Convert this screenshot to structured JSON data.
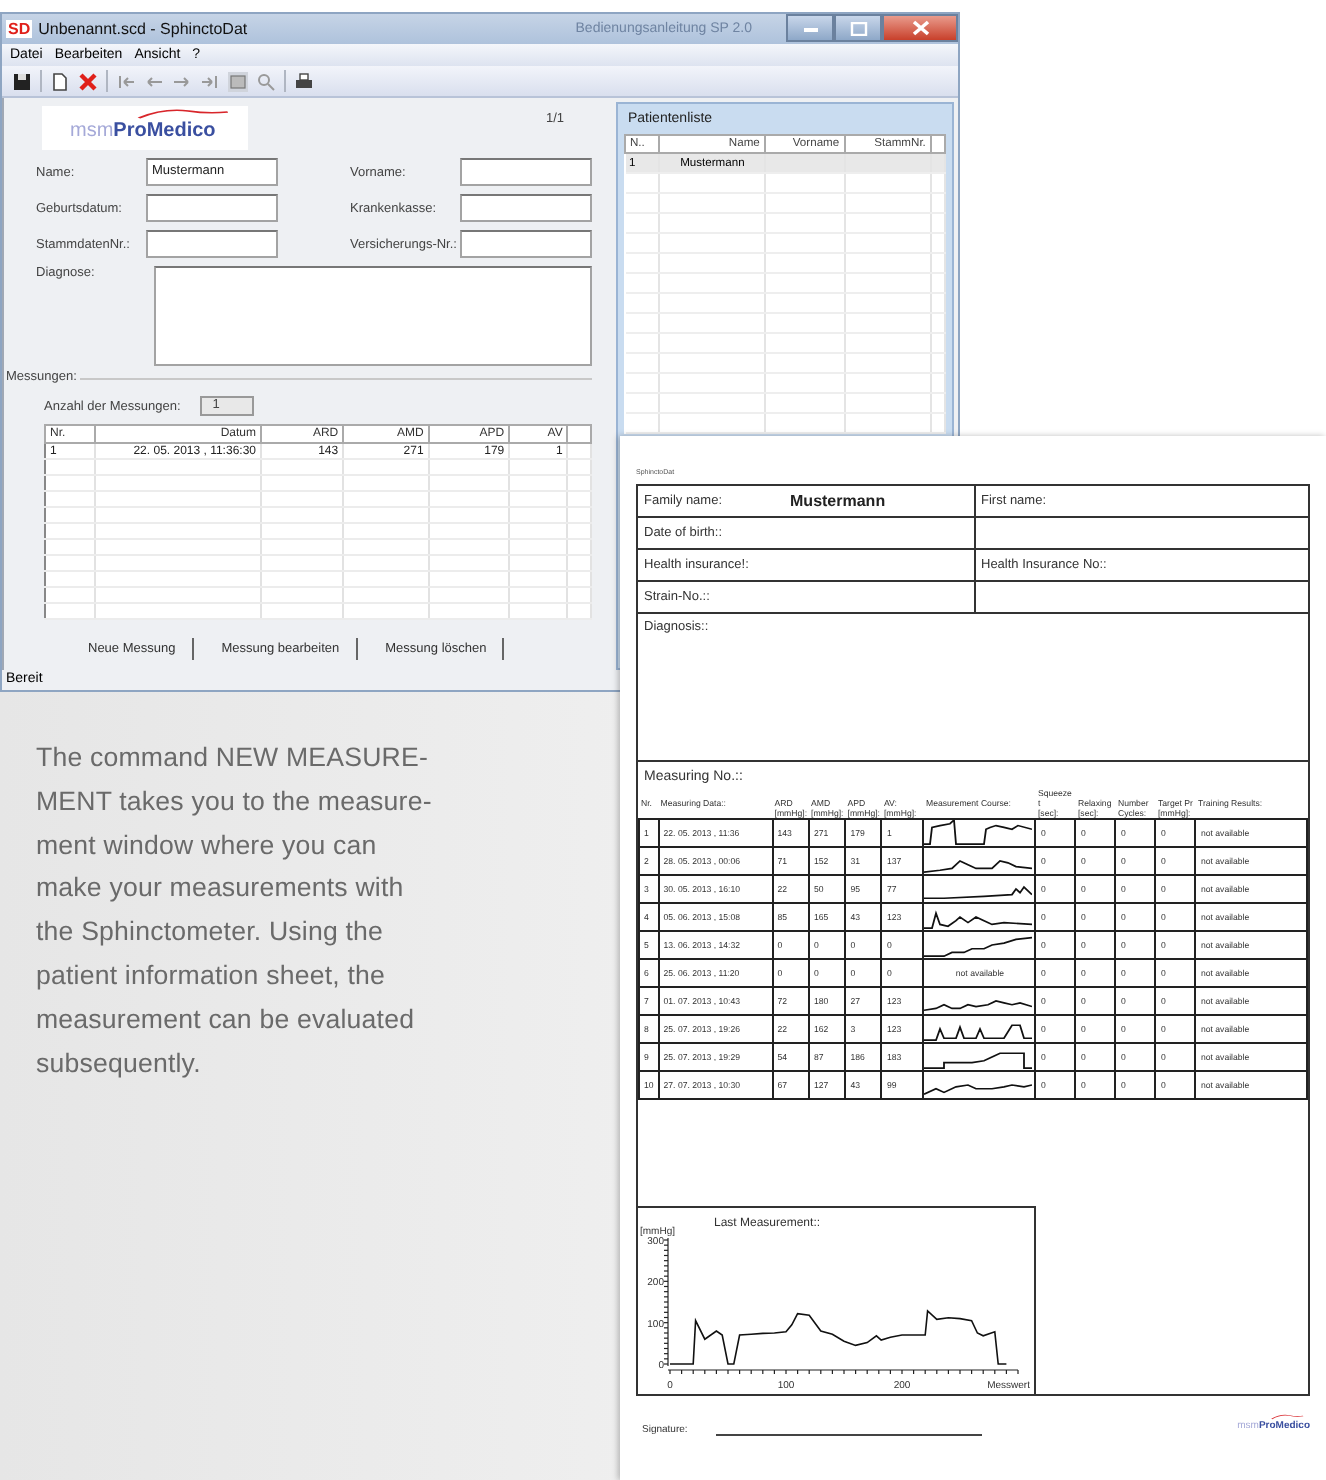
{
  "window": {
    "icon_text": "SD",
    "title": "Unbenannt.scd - SphinctoDat",
    "background_title": "Bedienungsanleitung SP 2.0"
  },
  "menu": [
    "Datei",
    "Bearbeiten",
    "Ansicht",
    "?"
  ],
  "form": {
    "logo": {
      "prefix": "msm",
      "name": "ProMedico"
    },
    "page": "1/1",
    "fields": [
      {
        "label": "Name:",
        "value": "Mustermann"
      },
      {
        "label": "Vorname:"
      },
      {
        "label": "Geburtsdatum:"
      },
      {
        "label": "Krankenkasse:"
      },
      {
        "label": "StammdatenNr.:"
      },
      {
        "label": "Versicherungs-Nr.:"
      }
    ],
    "diagnosis_label": "Diagnose:"
  },
  "measurements": {
    "legend": "Messungen:",
    "count_label": "Anzahl der Messungen:",
    "count": "1",
    "columns": [
      "Nr.",
      "Datum",
      "ARD",
      "AMD",
      "APD",
      "AV"
    ],
    "rows": [
      [
        "1",
        "22. 05. 2013 , 11:36:30",
        "143",
        "271",
        "179",
        "1"
      ]
    ],
    "buttons": [
      "Neue Messung",
      "Messung bearbeiten",
      "Messung löschen"
    ]
  },
  "patient_list": {
    "title": "Patientenliste",
    "columns": [
      "N..",
      "Name",
      "Vorname",
      "StammNr."
    ],
    "rows": [
      {
        "cells": [
          "1",
          "Mustermann"
        ],
        "selected": true
      }
    ]
  },
  "status_bar": "Bereit",
  "description": "The command NEW MEASURE-\nMENT takes you to the measure-\nment window where you can\nmake your measurements with\nthe Sphinctometer. Using the\npatient information sheet, the\nmeasurement can be evaluated\nsubsequently.",
  "report": {
    "app_name": "SphinctoDat",
    "patient_rows": [
      {
        "label": "Family name:",
        "value": "Mustermann",
        "right_label": "First name:"
      },
      {
        "label": "Date of birth::"
      },
      {
        "label": "Health insurance!:",
        "right_label": "Health Insurance No::"
      },
      {
        "label": "Strain-No.::"
      }
    ],
    "diagnosis_label": "Diagnosis::",
    "measuring_label": "Measuring No.::",
    "columns": [
      {
        "label": "Nr."
      },
      {
        "label": "Measuring Data::"
      },
      {
        "label": "ARD",
        "unit": "[mmHg]:"
      },
      {
        "label": "AMD",
        "unit": "[mmHg]:"
      },
      {
        "label": "APD",
        "unit": "[mmHg]:"
      },
      {
        "label": "AV:",
        "unit": "[mmHg]:"
      },
      {
        "label": "Measurement Course:"
      },
      {
        "label": "Squeeze t",
        "unit": "[sec]:"
      },
      {
        "label": "Relaxing",
        "unit": "[sec]:"
      },
      {
        "label": "Number",
        "unit": "Cycles:"
      },
      {
        "label": "Target Pr",
        "unit": "[mmHg]:"
      },
      {
        "label": "Training Results:"
      }
    ],
    "rows": [
      {
        "cells": [
          "1",
          "22. 05. 2013 , 11:36",
          "143",
          "271",
          "179",
          "1"
        ],
        "after": [
          "0",
          "0",
          "0",
          "0",
          "not available"
        ]
      },
      {
        "cells": [
          "2",
          "28. 05. 2013 , 00:06",
          "71",
          "152",
          "31",
          "137"
        ],
        "after": [
          "0",
          "0",
          "0",
          "0",
          "not available"
        ]
      },
      {
        "cells": [
          "3",
          "30. 05. 2013 , 16:10",
          "22",
          "50",
          "95",
          "77"
        ],
        "after": [
          "0",
          "0",
          "0",
          "0",
          "not available"
        ]
      },
      {
        "cells": [
          "4",
          "05. 06. 2013 , 15:08",
          "85",
          "165",
          "43",
          "123"
        ],
        "after": [
          "0",
          "0",
          "0",
          "0",
          "not available"
        ]
      },
      {
        "cells": [
          "5",
          "13. 06. 2013 , 14:32",
          "0",
          "0",
          "0",
          "0"
        ],
        "after": [
          "0",
          "0",
          "0",
          "0",
          "not available"
        ]
      },
      {
        "cells": [
          "6",
          "25. 06. 2013 , 11:20",
          "0",
          "0",
          "0",
          "0"
        ],
        "course": "not available",
        "after": [
          "0",
          "0",
          "0",
          "0",
          "not available"
        ]
      },
      {
        "cells": [
          "7",
          "01. 07. 2013 , 10:43",
          "72",
          "180",
          "27",
          "123"
        ],
        "after": [
          "0",
          "0",
          "0",
          "0",
          "not available"
        ]
      },
      {
        "cells": [
          "8",
          "25. 07. 2013 , 19:26",
          "22",
          "162",
          "3",
          "123"
        ],
        "after": [
          "0",
          "0",
          "0",
          "0",
          "not available"
        ]
      },
      {
        "cells": [
          "9",
          "25. 07. 2013 , 19:29",
          "54",
          "87",
          "186",
          "183"
        ],
        "after": [
          "0",
          "0",
          "0",
          "0",
          "not available"
        ]
      },
      {
        "cells": [
          "10",
          "27. 07. 2013 , 10:30",
          "67",
          "127",
          "43",
          "99"
        ],
        "after": [
          "0",
          "0",
          "0",
          "0",
          "not available"
        ]
      }
    ],
    "last_measurement": {
      "chart_data": {
        "type": "line",
        "title": "Last Measurement::",
        "xlabel": "Messwert",
        "ylabel": "[mmHg]",
        "x": [
          0,
          10,
          20,
          22,
          30,
          40,
          45,
          50,
          55,
          60,
          70,
          80,
          90,
          100,
          105,
          110,
          120,
          130,
          140,
          150,
          160,
          170,
          178,
          182,
          190,
          200,
          210,
          220,
          222,
          230,
          240,
          250,
          260,
          265,
          270,
          280,
          283,
          290
        ],
        "series": [
          {
            "color": "#111111",
            "values": [
              0,
              0,
              0,
              105,
              60,
              80,
              70,
              0,
              0,
              70,
              72,
              74,
              75,
              78,
              95,
              122,
              118,
              80,
              72,
              55,
              45,
              52,
              68,
              58,
              65,
              70,
              70,
              70,
              128,
              108,
              112,
              110,
              105,
              75,
              68,
              78,
              0,
              0
            ]
          }
        ],
        "xlim": [
          0,
          300
        ],
        "ylim": [
          0,
          300
        ],
        "xticks": [
          0,
          100,
          200
        ],
        "yticks": [
          0,
          100,
          200,
          300
        ]
      }
    },
    "signature_label": "Signature:",
    "logo": {
      "prefix": "msm",
      "name": "ProMedico"
    }
  }
}
